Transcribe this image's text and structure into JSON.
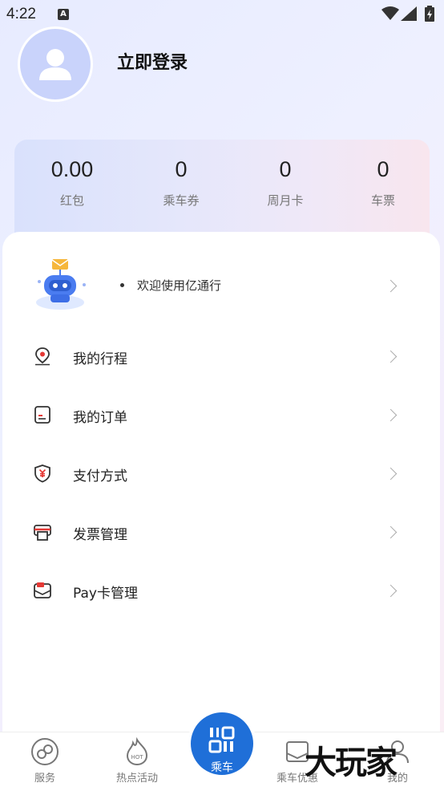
{
  "status_bar": {
    "time": "4:22",
    "notification_icon": "A"
  },
  "header": {
    "login_text": "立即登录"
  },
  "stats": [
    {
      "value": "0.00",
      "label": "红包"
    },
    {
      "value": "0",
      "label": "乘车券"
    },
    {
      "value": "0",
      "label": "周月卡"
    },
    {
      "value": "0",
      "label": "车票"
    }
  ],
  "welcome": {
    "text": "欢迎使用亿通行"
  },
  "menu": [
    {
      "label": "我的行程",
      "icon": "location-pin-icon"
    },
    {
      "label": "我的订单",
      "icon": "order-doc-icon"
    },
    {
      "label": "支付方式",
      "icon": "yuan-shield-icon"
    },
    {
      "label": "发票管理",
      "icon": "invoice-printer-icon"
    },
    {
      "label": "Pay卡管理",
      "icon": "pay-card-icon"
    }
  ],
  "bottom_nav": {
    "services": "服务",
    "hot_events": "热点活动",
    "ride": "乘车",
    "discounts": "乘车优惠",
    "mine": "我的"
  },
  "watermark": {
    "text": "大玩家"
  },
  "colors": {
    "accent": "#1f6fd8",
    "icon_red": "#e53935"
  }
}
